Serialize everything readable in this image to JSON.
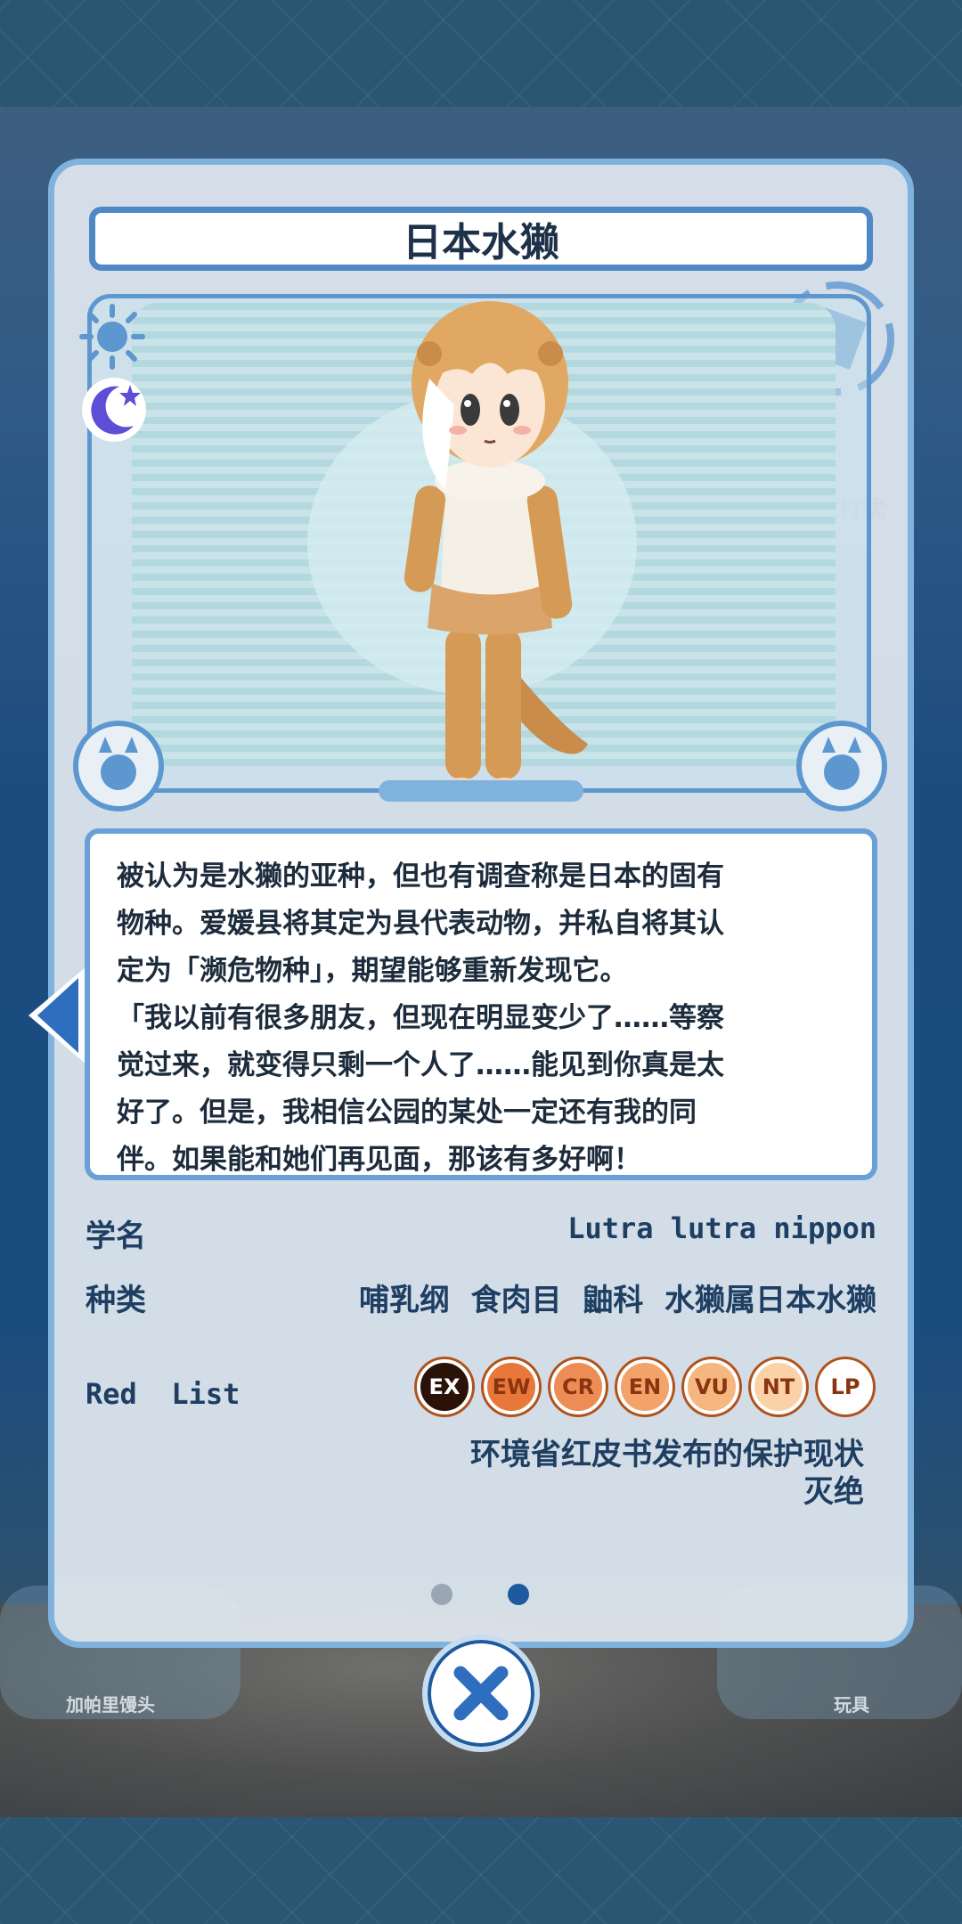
{
  "card": {
    "title": "日本水獭",
    "description": "被认为是水獭的亚种，但也有调查称是日本的固有\n物种。爱媛县将其定为县代表动物，并私自将其认\n定为「濒危物种」，期望能够重新发现它。\n「我以前有很多朋友，但现在明显变少了……等察\n觉过来，就变得只剩一个人了……能见到你真是太\n好了。但是，我相信公园的某处一定还有我的同\n伴。如果能和她们再见面，那该有多好啊！"
  },
  "info": {
    "scientific_name_label": "学名",
    "scientific_name_value": "Lutra  lutra  nippon",
    "taxonomy_label": "种类",
    "taxonomy_value": "哺乳纲  食肉目  鼬科  水獭属日本水獭",
    "red_list_label": "Red  List",
    "red_list_badges": [
      "EX",
      "EW",
      "CR",
      "EN",
      "VU",
      "NT",
      "LP"
    ],
    "red_list_selected": "EX",
    "status_title": "环境省红皮书发布的保护现状",
    "status_value": "灭绝"
  },
  "background": {
    "left_label": "加帕里馒头",
    "right_label": "玩具",
    "faded_right_label": "隐藏打扰"
  },
  "pager": {
    "current_page": 2,
    "total_pages": 2
  },
  "colors": {
    "accent_blue": "#4e88c5",
    "badge_selected": "#2a1208",
    "badge_orange": "#e8783a",
    "badge_light_orange": "#f3a36a",
    "text_dark": "#1e3e62"
  },
  "icons": {
    "sun": "sun-icon",
    "moon": "moon-star-icon",
    "close": "close-icon",
    "left_arrow": "left-arrow-icon"
  }
}
